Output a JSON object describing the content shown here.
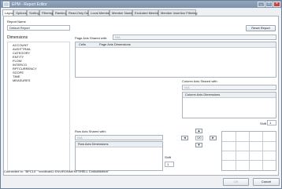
{
  "window": {
    "title": "EPM - Report Editor",
    "controls": {
      "minimize": "_",
      "maximize": "□",
      "close": "×"
    }
  },
  "tabs": [
    {
      "label": "Layout"
    },
    {
      "label": "Options"
    },
    {
      "label": "Sorting"
    },
    {
      "label": "Filtering"
    },
    {
      "label": "Ranking"
    },
    {
      "label": "Read-Only Data"
    },
    {
      "label": "Local Members"
    },
    {
      "label": "Member Names"
    },
    {
      "label": "Excluded Members"
    },
    {
      "label": "Member Insertion Filtering"
    }
  ],
  "report": {
    "name_label": "Report Name",
    "name_value": "Default Report",
    "reset_label": "Reset Report"
  },
  "dimensions": {
    "label": "Dimensions",
    "items": [
      "ACCOUNT",
      "AUDITTRAIL",
      "CATEGORY",
      "ENTITY",
      "FLOW",
      "INTERCO",
      "RPTCURRENCY",
      "SCOPE",
      "TIME",
      "MEASURES"
    ]
  },
  "page_axis": {
    "label": "Page Axis Shared with:",
    "select_value": "N/A",
    "cols": [
      "Cells",
      "Page Axis Dimensions"
    ]
  },
  "column_axis": {
    "label": "Column Axis Shared with:",
    "select_value": "N/A",
    "header": "Column Axis Dimensions",
    "shift_label": "Shift",
    "shift_value": "1"
  },
  "row_axis": {
    "label": "Row Axis Shared with:",
    "select_value": "N/A",
    "header": "Row Axis Dimensions",
    "shift_label": "Shift",
    "shift_value": "1"
  },
  "nav": {
    "center": "0/0"
  },
  "status": "Connected to: \"BPC10\" \"xxx/dbat41 ENVIRONMENTSHELL Consolidation\"",
  "footer": {
    "ok_label": "OK",
    "cancel_label": "Cancel"
  }
}
